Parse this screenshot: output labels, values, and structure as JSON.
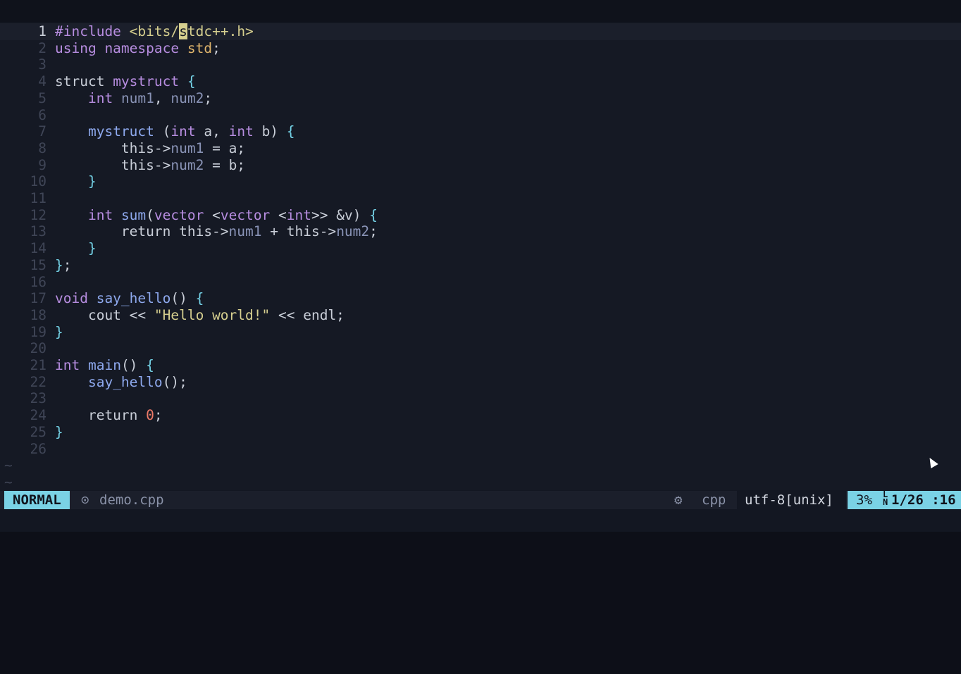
{
  "editor": {
    "lines": [
      {
        "n": "1",
        "current": true,
        "segments": [
          [
            "pre",
            "#include "
          ],
          [
            "str",
            "<bits/"
          ],
          [
            "cursor",
            "s"
          ],
          [
            "str",
            "tdc++.h>"
          ]
        ]
      },
      {
        "n": "2",
        "segments": [
          [
            "kw",
            "using namespace "
          ],
          [
            "ns",
            "std"
          ],
          [
            "plain",
            ";"
          ]
        ]
      },
      {
        "n": "3",
        "segments": []
      },
      {
        "n": "4",
        "segments": [
          [
            "plain",
            "struct "
          ],
          [
            "type",
            "mystruct "
          ],
          [
            "br",
            "{"
          ]
        ]
      },
      {
        "n": "5",
        "segments": [
          [
            "plain",
            "    "
          ],
          [
            "type",
            "int "
          ],
          [
            "var",
            "num1"
          ],
          [
            "plain",
            ", "
          ],
          [
            "var",
            "num2"
          ],
          [
            "plain",
            ";"
          ]
        ]
      },
      {
        "n": "6",
        "segments": []
      },
      {
        "n": "7",
        "segments": [
          [
            "plain",
            "    "
          ],
          [
            "fn",
            "mystruct "
          ],
          [
            "plain",
            "("
          ],
          [
            "type",
            "int "
          ],
          [
            "plain",
            "a, "
          ],
          [
            "type",
            "int "
          ],
          [
            "plain",
            "b) "
          ],
          [
            "br",
            "{"
          ]
        ]
      },
      {
        "n": "8",
        "segments": [
          [
            "plain",
            "        this->"
          ],
          [
            "var",
            "num1"
          ],
          [
            "plain",
            " = a;"
          ]
        ]
      },
      {
        "n": "9",
        "segments": [
          [
            "plain",
            "        this->"
          ],
          [
            "var",
            "num2"
          ],
          [
            "plain",
            " = b;"
          ]
        ]
      },
      {
        "n": "10",
        "segments": [
          [
            "plain",
            "    "
          ],
          [
            "br",
            "}"
          ]
        ]
      },
      {
        "n": "11",
        "segments": []
      },
      {
        "n": "12",
        "segments": [
          [
            "plain",
            "    "
          ],
          [
            "type",
            "int "
          ],
          [
            "fn",
            "sum"
          ],
          [
            "plain",
            "("
          ],
          [
            "type",
            "vector "
          ],
          [
            "plain",
            "<"
          ],
          [
            "type",
            "vector "
          ],
          [
            "plain",
            "<"
          ],
          [
            "type",
            "int"
          ],
          [
            "plain",
            ">> &v) "
          ],
          [
            "br",
            "{"
          ]
        ]
      },
      {
        "n": "13",
        "segments": [
          [
            "plain",
            "        return this->"
          ],
          [
            "var",
            "num1"
          ],
          [
            "plain",
            " + this->"
          ],
          [
            "var",
            "num2"
          ],
          [
            "plain",
            ";"
          ]
        ]
      },
      {
        "n": "14",
        "segments": [
          [
            "plain",
            "    "
          ],
          [
            "br",
            "}"
          ]
        ]
      },
      {
        "n": "15",
        "segments": [
          [
            "br",
            "}"
          ],
          [
            "plain",
            ";"
          ]
        ]
      },
      {
        "n": "16",
        "segments": []
      },
      {
        "n": "17",
        "segments": [
          [
            "type",
            "void "
          ],
          [
            "fn",
            "say_hello"
          ],
          [
            "plain",
            "() "
          ],
          [
            "br",
            "{"
          ]
        ]
      },
      {
        "n": "18",
        "segments": [
          [
            "plain",
            "    cout << "
          ],
          [
            "str",
            "\"Hello world!\""
          ],
          [
            "plain",
            " << endl;"
          ]
        ]
      },
      {
        "n": "19",
        "segments": [
          [
            "br",
            "}"
          ]
        ]
      },
      {
        "n": "20",
        "segments": []
      },
      {
        "n": "21",
        "segments": [
          [
            "type",
            "int "
          ],
          [
            "fn",
            "main"
          ],
          [
            "plain",
            "() "
          ],
          [
            "br",
            "{"
          ]
        ]
      },
      {
        "n": "22",
        "segments": [
          [
            "plain",
            "    "
          ],
          [
            "fn",
            "say_hello"
          ],
          [
            "plain",
            "();"
          ]
        ]
      },
      {
        "n": "23",
        "segments": []
      },
      {
        "n": "24",
        "segments": [
          [
            "plain",
            "    return "
          ],
          [
            "num",
            "0"
          ],
          [
            "plain",
            ";"
          ]
        ]
      },
      {
        "n": "25",
        "segments": [
          [
            "br",
            "}"
          ]
        ]
      },
      {
        "n": "26",
        "segments": []
      }
    ],
    "tilde_lines": [
      "~",
      "~"
    ]
  },
  "statusline": {
    "mode": "NORMAL",
    "file_icon": "file-icon",
    "file_icon_glyph": "⊙",
    "filename": "demo.cpp",
    "gears_icon": "gears-icon",
    "gears_glyph": "⚙",
    "filetype": "cpp",
    "encoding": "utf-8[unix]",
    "percent": "3%",
    "ln_glyph_top": "L",
    "ln_glyph_bottom": "N",
    "position": "1/26 :16"
  },
  "colors": {
    "mode_bg": "#7ad2e5",
    "keyword": "#b78de0",
    "string": "#d6cf8f",
    "function": "#8ea9ee",
    "number": "#ee7a68"
  }
}
